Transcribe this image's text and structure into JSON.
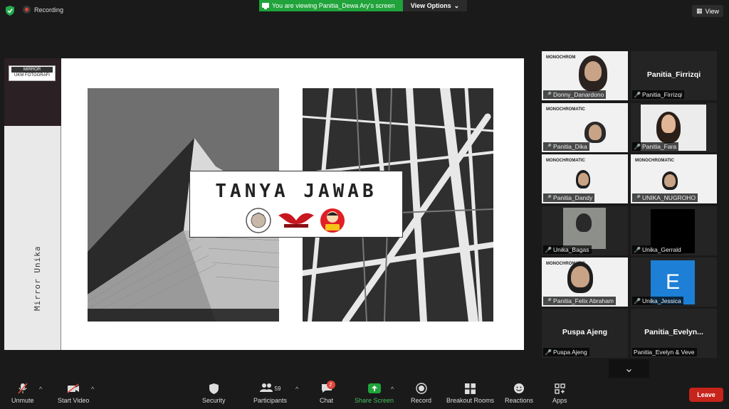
{
  "top": {
    "recording": "Recording",
    "viewing": "You are viewing Panitia_Dewa Ary's screen",
    "view_options": "View Options",
    "view": "View"
  },
  "slide": {
    "logo_line1": "MIRROR",
    "logo_line2": "UKM FOTOGRAFI",
    "side_text": "Mirror Unika",
    "title": "TANYA JAWAB"
  },
  "participants": [
    {
      "name": "Donny_Danardono",
      "kind": "video",
      "active": true
    },
    {
      "name": "Panitia_Firrizqi",
      "kind": "name",
      "big": "Panitia_Firrizqi"
    },
    {
      "name": "Panitia_Dika",
      "kind": "video"
    },
    {
      "name": "Panitia_Fara",
      "kind": "video"
    },
    {
      "name": "Panitia_Dandy",
      "kind": "video"
    },
    {
      "name": "UNIKA_NUGROHO",
      "kind": "video"
    },
    {
      "name": "Unika_Bagas",
      "kind": "video"
    },
    {
      "name": "Unika_Gerrald",
      "kind": "black"
    },
    {
      "name": "Panitia_Felix Abraham",
      "kind": "video"
    },
    {
      "name": "Unika_Jessica",
      "kind": "avatar",
      "letter": "E"
    },
    {
      "name": "Puspa Ajeng",
      "kind": "name",
      "big": "Puspa Ajeng"
    },
    {
      "name": "Panitia_Evelyn & Veve",
      "kind": "name",
      "big": "Panitia_Evelyn..."
    }
  ],
  "toolbar": {
    "unmute": "Unmute",
    "start_video": "Start Video",
    "security": "Security",
    "participants": "Participants",
    "participants_count": "59",
    "chat": "Chat",
    "chat_badge": "2",
    "share_screen": "Share Screen",
    "record": "Record",
    "breakout_rooms": "Breakout Rooms",
    "reactions": "Reactions",
    "apps": "Apps",
    "leave": "Leave"
  },
  "colors": {
    "share_green": "#1fa33a",
    "leave_red": "#c7241b",
    "active_speaker": "#9bd54a"
  }
}
